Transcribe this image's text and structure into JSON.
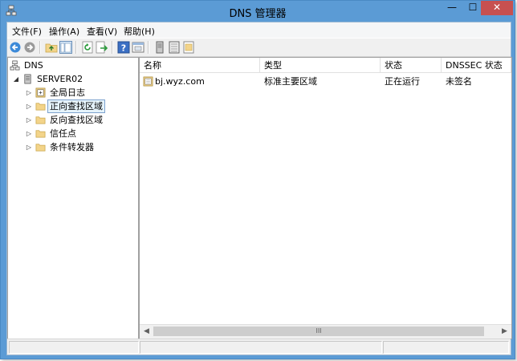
{
  "window": {
    "title": "DNS 管理器",
    "minimize_glyph": "—",
    "maximize_glyph": "☐",
    "close_glyph": "✕"
  },
  "menu": [
    {
      "label": "文件(F)"
    },
    {
      "label": "操作(A)"
    },
    {
      "label": "查看(V)"
    },
    {
      "label": "帮助(H)"
    }
  ],
  "toolbar": {
    "icons": [
      "back-icon",
      "forward-icon",
      "up-folder-icon",
      "show-hide-console-tree-icon",
      "refresh-icon",
      "export-list-icon",
      "help-icon",
      "properties-icon",
      "server-icon",
      "zone-icon",
      "record-icon"
    ]
  },
  "tree": {
    "root": {
      "label": "DNS"
    },
    "server": {
      "label": "SERVER02"
    },
    "items": [
      {
        "label": "全局日志"
      },
      {
        "label": "正向查找区域",
        "selected": true
      },
      {
        "label": "反向查找区域"
      },
      {
        "label": "信任点"
      },
      {
        "label": "条件转发器"
      }
    ],
    "expand_glyph": "▷",
    "collapse_glyph": "◢"
  },
  "list": {
    "columns": [
      "名称",
      "类型",
      "状态",
      "DNSSEC 状态"
    ],
    "rows": [
      {
        "name": "bj.wyz.com",
        "type": "标准主要区域",
        "status": "正在运行",
        "dnssec": "未签名"
      }
    ],
    "scroll_left_glyph": "◀",
    "scroll_right_glyph": "▶",
    "scroll_thumb_glyph": "III"
  },
  "colors": {
    "titlebar": "#5b9bd5",
    "close_button": "#c75050",
    "folder": "#f3d48a",
    "selection_border": "#7da2ce"
  }
}
